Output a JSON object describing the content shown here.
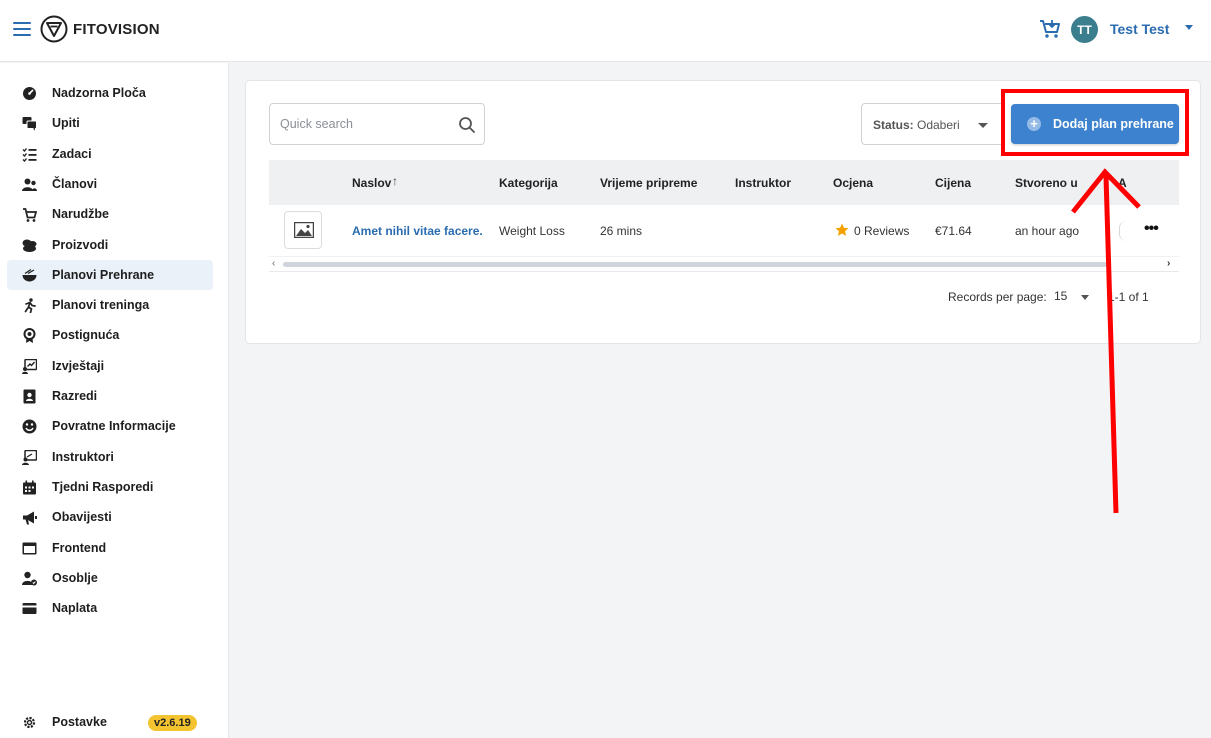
{
  "app": {
    "brand": "FITOVISION",
    "user_initials": "TT",
    "user_name": "Test Test"
  },
  "sidebar": {
    "items": [
      {
        "label": "Nadzorna Ploča",
        "icon": "dashboard-icon"
      },
      {
        "label": "Upiti",
        "icon": "chat-icon"
      },
      {
        "label": "Zadaci",
        "icon": "tasks-icon"
      },
      {
        "label": "Članovi",
        "icon": "members-icon"
      },
      {
        "label": "Narudžbe",
        "icon": "cart-icon"
      },
      {
        "label": "Proizvodi",
        "icon": "products-icon"
      },
      {
        "label": "Planovi Prehrane",
        "icon": "food-bowl-icon",
        "active": true
      },
      {
        "label": "Planovi treninga",
        "icon": "running-icon"
      },
      {
        "label": "Postignuća",
        "icon": "award-icon"
      },
      {
        "label": "Izvještaji",
        "icon": "report-icon"
      },
      {
        "label": "Razredi",
        "icon": "class-icon"
      },
      {
        "label": "Povratne Informacije",
        "icon": "smiley-icon"
      },
      {
        "label": "Instruktori",
        "icon": "instructor-icon"
      },
      {
        "label": "Tjedni Rasporedi",
        "icon": "calendar-icon"
      },
      {
        "label": "Obavijesti",
        "icon": "megaphone-icon"
      },
      {
        "label": "Frontend",
        "icon": "window-icon"
      },
      {
        "label": "Osoblje",
        "icon": "staff-icon"
      },
      {
        "label": "Naplata",
        "icon": "credit-card-icon"
      }
    ],
    "settings_label": "Postavke",
    "version": "v2.6.19"
  },
  "toolbar": {
    "search_placeholder": "Quick search",
    "status_label": "Status:",
    "status_value": "Odaberi",
    "add_label": "Dodaj plan prehrane"
  },
  "table": {
    "columns": [
      "Naslov",
      "Kategorija",
      "Vrijeme pripreme",
      "Instruktor",
      "Ocjena",
      "Cijena",
      "Stvoreno u",
      "A"
    ],
    "rows": [
      {
        "title": "Amet nihil vitae facere.",
        "category": "Weight Loss",
        "prep_time": "26 mins",
        "instructor": "",
        "rating": "0 Reviews",
        "price": "€71.64",
        "created": "an hour ago"
      }
    ]
  },
  "pagination": {
    "label": "Records per page:",
    "per_page": "15",
    "range": "1-1 of 1"
  },
  "colors": {
    "accent": "#3d82cf",
    "link": "#2b6cb0",
    "annotation": "#ff0000",
    "badge": "#f4c430"
  }
}
